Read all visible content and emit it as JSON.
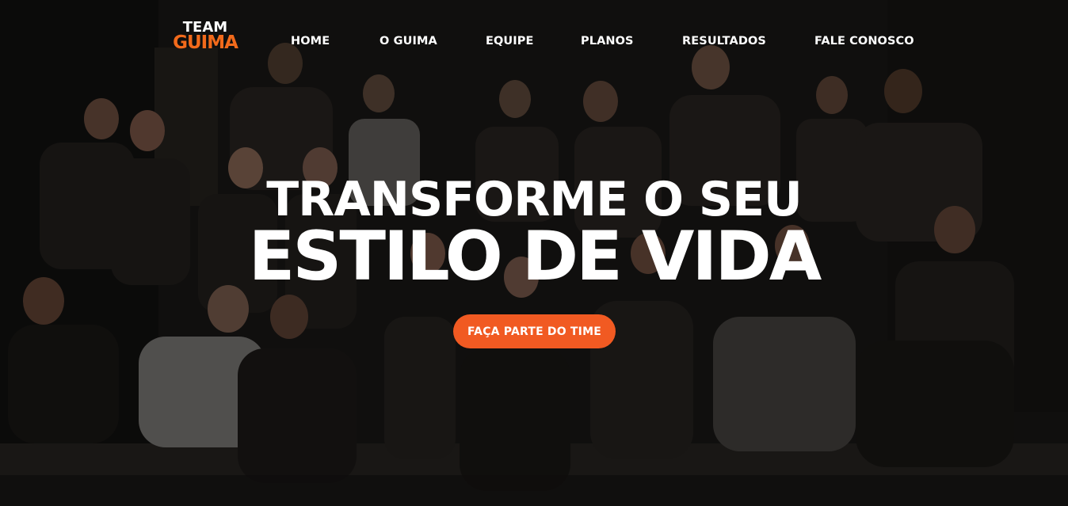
{
  "colors": {
    "accent": "#f15a22",
    "logo_accent": "#f26a1b",
    "text": "#ffffff"
  },
  "logo": {
    "line1": "TEAM",
    "line2": "GUIMA"
  },
  "nav": {
    "items": [
      {
        "label": "HOME"
      },
      {
        "label": "O GUIMA"
      },
      {
        "label": "EQUIPE"
      },
      {
        "label": "PLANOS"
      },
      {
        "label": "RESULTADOS"
      },
      {
        "label": "FALE CONOSCO"
      }
    ]
  },
  "hero": {
    "headline_line1": "TRANSFORME O SEU",
    "headline_line2": "ESTILO DE VIDA",
    "cta_label": "FAÇA PARTE DO TIME",
    "background": "group photo of gym team"
  }
}
